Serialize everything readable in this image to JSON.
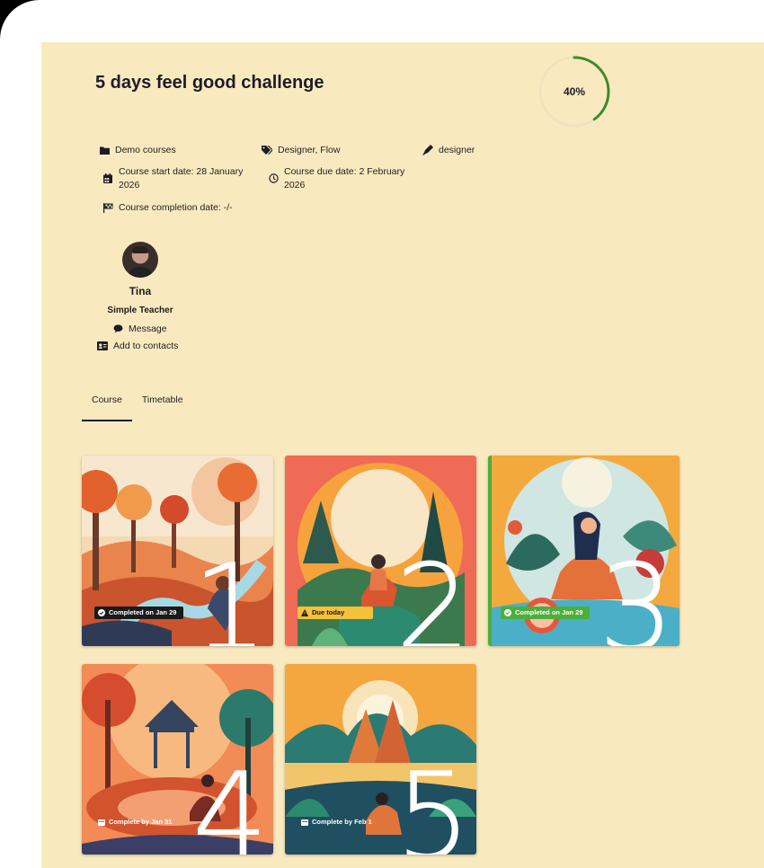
{
  "course": {
    "title": "5 days feel good challenge",
    "progress_label": "40%",
    "progress": 0.4
  },
  "meta": {
    "category": "Demo courses",
    "tags": "Designer, Flow",
    "author": "designer",
    "start_date": "Course start date: 28 January 2026",
    "due_date": "Course due date: 2 February 2026",
    "completion_date": "Course completion date: -/-"
  },
  "teacher": {
    "name": "Tina",
    "role": "Simple Teacher",
    "message_label": "Message",
    "contacts_label": "Add to contacts"
  },
  "tabs": [
    {
      "label": "Course",
      "active": true
    },
    {
      "label": "Timetable",
      "active": false
    }
  ],
  "lessons": [
    {
      "number": "1",
      "badge": "Completed on Jan 29",
      "status": "completed"
    },
    {
      "number": "2",
      "badge": "Due today",
      "status": "due"
    },
    {
      "number": "3",
      "badge": "Completed on Jan 29",
      "status": "completed-accent"
    },
    {
      "number": "4",
      "badge": "Complete by Jan 31",
      "status": "upcoming"
    },
    {
      "number": "5",
      "badge": "Complete by Feb 1",
      "status": "upcoming"
    }
  ],
  "colors": {
    "background": "#f9e9bf",
    "progress": "#3e8a2a",
    "completed_green": "#4caf3a",
    "due_yellow": "#f4c13a"
  },
  "icons": {
    "category": "folder-icon",
    "tags": "tags-icon",
    "author": "pen-icon",
    "start_date": "calendar-icon",
    "due_date": "clock-icon",
    "completion_date": "flag-icon",
    "message": "chat-icon",
    "contacts": "contact-card-icon"
  }
}
